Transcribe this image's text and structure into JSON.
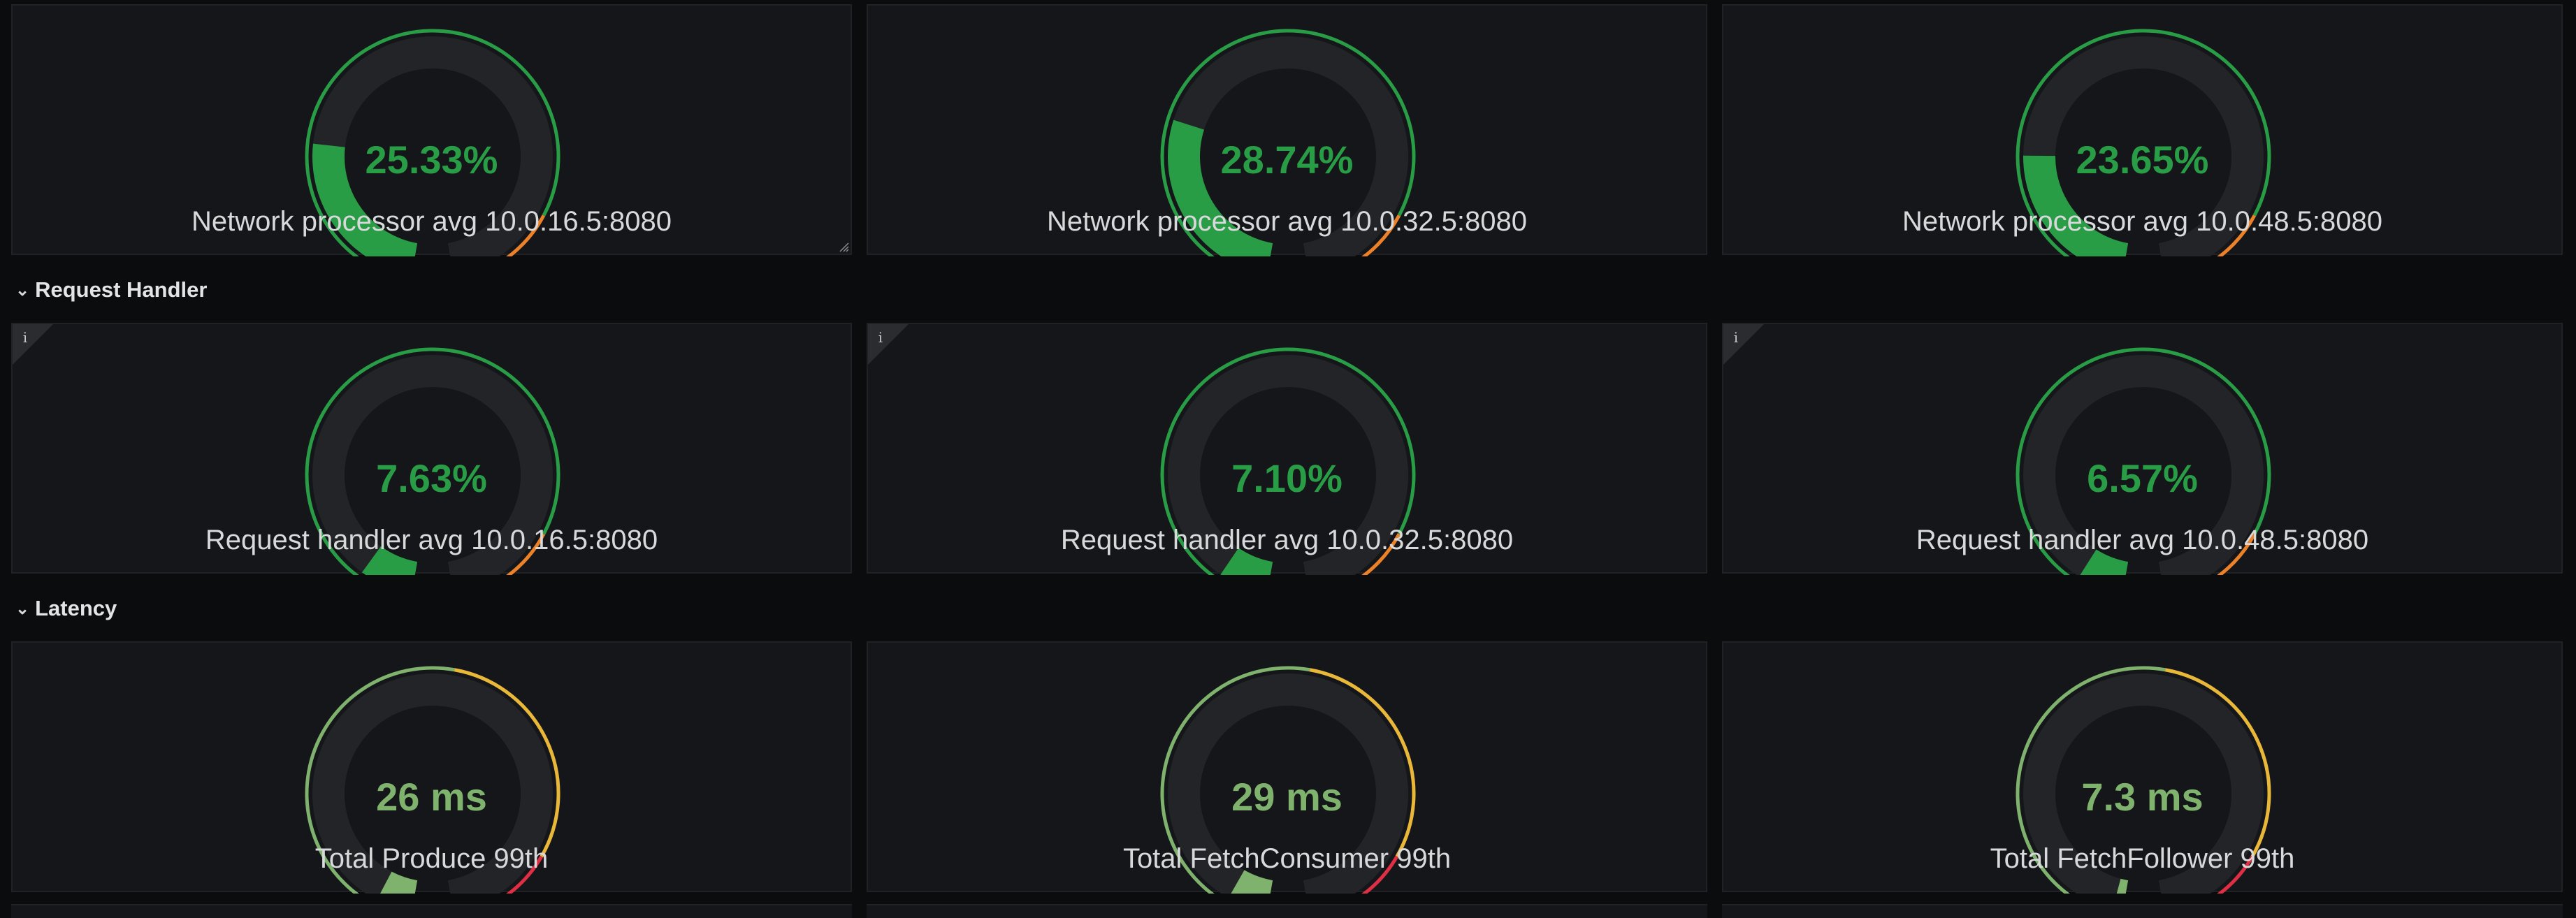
{
  "colors": {
    "green": "#299c46",
    "light_green": "#7eb26d",
    "orange": "#ed8128",
    "yellow": "#eab839",
    "red": "#e02f44",
    "track": "#222427"
  },
  "rows": [
    {
      "header": "",
      "panels": [
        {
          "value_text": "25.33%",
          "value": 25.33,
          "max": 100,
          "title": "Network processor avg 10.0.16.5:8080",
          "info": false,
          "scheme": "percent",
          "resize": true
        },
        {
          "value_text": "28.74%",
          "value": 28.74,
          "max": 100,
          "title": "Network processor avg 10.0.32.5:8080",
          "info": false,
          "scheme": "percent",
          "resize": false
        },
        {
          "value_text": "23.65%",
          "value": 23.65,
          "max": 100,
          "title": "Network processor avg 10.0.48.5:8080",
          "info": false,
          "scheme": "percent",
          "resize": false
        }
      ]
    },
    {
      "header": "Request Handler",
      "panels": [
        {
          "value_text": "7.63%",
          "value": 7.63,
          "max": 100,
          "title": "Request handler avg 10.0.16.5:8080",
          "info": true,
          "scheme": "percent",
          "resize": false
        },
        {
          "value_text": "7.10%",
          "value": 7.1,
          "max": 100,
          "title": "Request handler avg 10.0.32.5:8080",
          "info": true,
          "scheme": "percent",
          "resize": false
        },
        {
          "value_text": "6.57%",
          "value": 6.57,
          "max": 100,
          "title": "Request handler avg 10.0.48.5:8080",
          "info": true,
          "scheme": "percent",
          "resize": false
        }
      ]
    },
    {
      "header": "Latency",
      "panels": [
        {
          "value_text": "26 ms",
          "value": 26,
          "max": 500,
          "title": "Total Produce 99th",
          "info": false,
          "scheme": "latency",
          "resize": false
        },
        {
          "value_text": "29 ms",
          "value": 29,
          "max": 500,
          "title": "Total FetchConsumer 99th",
          "info": false,
          "scheme": "latency",
          "resize": false
        },
        {
          "value_text": "7.3 ms",
          "value": 7.3,
          "max": 500,
          "title": "Total FetchFollower 99th",
          "info": false,
          "scheme": "latency",
          "resize": false
        }
      ]
    }
  ],
  "info_icon": "info-icon",
  "row_toggle_icon": "chevron-down-icon"
}
